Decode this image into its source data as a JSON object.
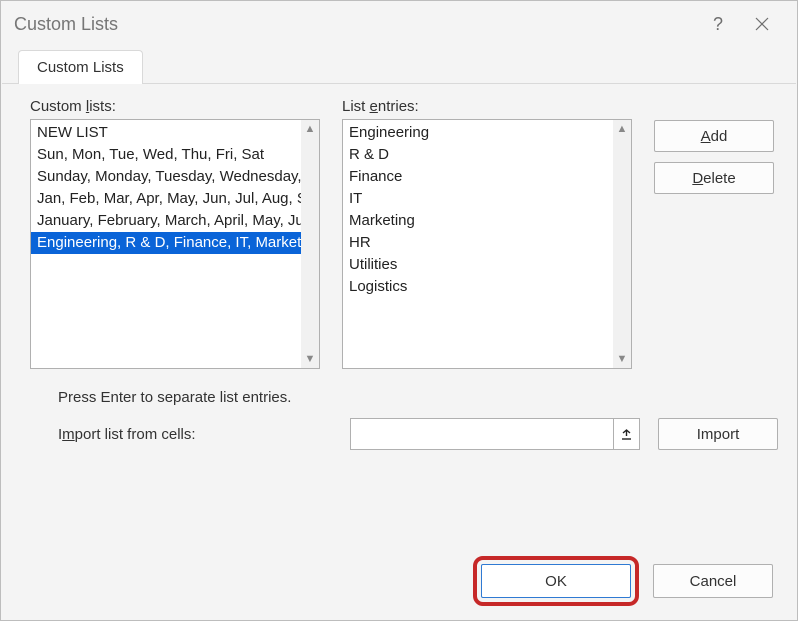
{
  "window": {
    "title": "Custom Lists"
  },
  "tabs": {
    "active": "Custom Lists"
  },
  "labels": {
    "custom_lists_prefix": "Custom ",
    "custom_lists_key": "l",
    "custom_lists_suffix": "ists:",
    "list_entries_prefix": "List ",
    "list_entries_key": "e",
    "list_entries_suffix": "ntries:",
    "help_text": "Press Enter to separate list entries.",
    "import_prefix": "I",
    "import_key": "m",
    "import_suffix": "port list from cells:"
  },
  "custom_lists": {
    "items": [
      "NEW LIST",
      "Sun, Mon, Tue, Wed, Thu, Fri, Sat",
      "Sunday, Monday, Tuesday, Wednesday, Thursday, Friday, Saturday",
      "Jan, Feb, Mar, Apr, May, Jun, Jul, Aug, Sep, Oct, Nov, Dec",
      "January, February, March, April, May, June, July, August, September, October, November, December",
      "Engineering, R & D, Finance, IT, Marketing, HR, Utilities, Logistics"
    ],
    "selected_index": 5
  },
  "list_entries": {
    "items": [
      "Engineering",
      "R & D",
      "Finance",
      "IT",
      "Marketing",
      "HR",
      "Utilities",
      "Logistics"
    ]
  },
  "buttons": {
    "add": "Add",
    "add_key": "A",
    "delete": "Delete",
    "delete_key": "D",
    "import": "Import",
    "ok": "OK",
    "cancel": "Cancel"
  },
  "import_cells": {
    "value": ""
  }
}
